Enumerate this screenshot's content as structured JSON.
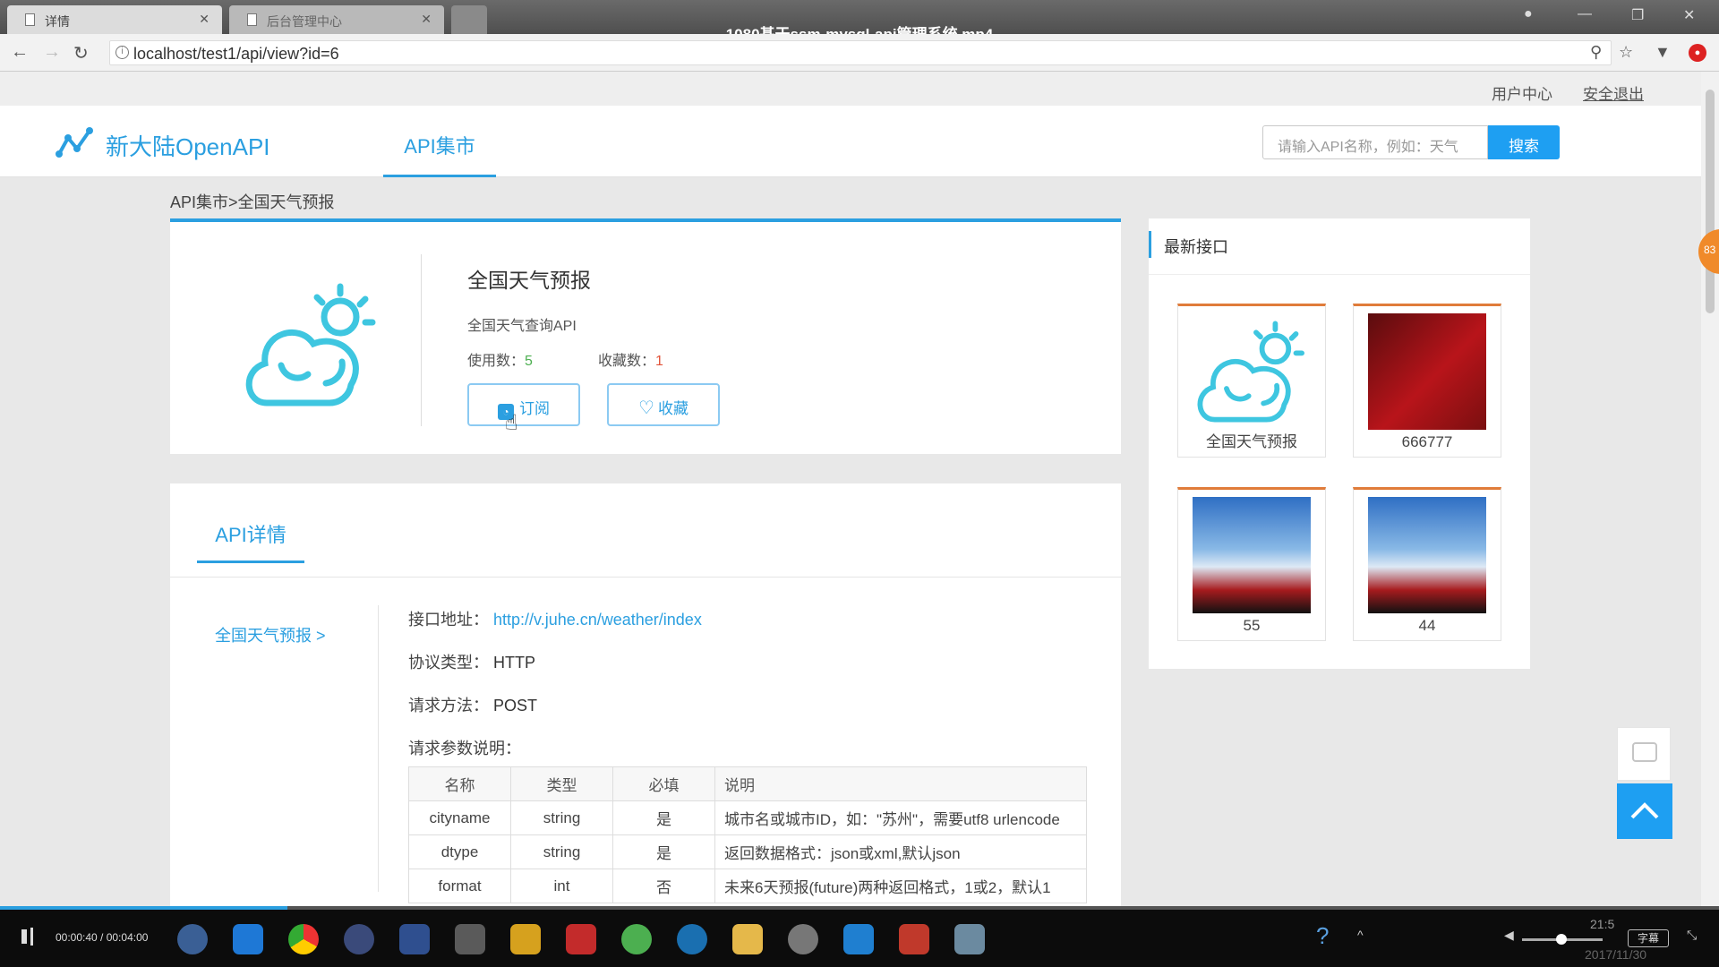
{
  "browser": {
    "tabs": [
      {
        "label": "详情"
      },
      {
        "label": "后台管理中心"
      }
    ],
    "video_title": "1080基于ssm-mysql-api管理系统.mp4",
    "url": "localhost/test1/api/view?id=6"
  },
  "userbar": {
    "user_center": "用户中心",
    "logout": "安全退出"
  },
  "header": {
    "logo_text": "新大陆OpenAPI",
    "nav_active": "API集市",
    "search_placeholder": "请输入API名称，例如：天气",
    "search_button": "搜索",
    "brand_color": "#2b9fe0"
  },
  "breadcrumb": "API集市>全国天气预报",
  "api": {
    "name": "全国天气预报",
    "desc": "全国天气查询API",
    "usage_label": "使用数：",
    "usage_count": "5",
    "fav_label": "收藏数：",
    "fav_count": "1",
    "subscribe_label": "订阅",
    "favorite_label": "收藏"
  },
  "detail": {
    "tab_label": "API详情",
    "side_link": "全国天气预报 >",
    "endpoint_label": "接口地址：",
    "endpoint": "http://v.juhe.cn/weather/index",
    "protocol_label": "协议类型：",
    "protocol": "HTTP",
    "method_label": "请求方法：",
    "method": "POST",
    "params_label": "请求参数说明：",
    "params_headers": [
      "名称",
      "类型",
      "必填",
      "说明"
    ],
    "params": [
      {
        "name": "cityname",
        "type": "string",
        "required": "是",
        "desc": "城市名或城市ID，如：\"苏州\"，需要utf8 urlencode"
      },
      {
        "name": "dtype",
        "type": "string",
        "required": "是",
        "desc": "返回数据格式：json或xml,默认json"
      },
      {
        "name": "format",
        "type": "int",
        "required": "否",
        "desc": "未来6天预报(future)两种返回格式，1或2，默认1"
      }
    ]
  },
  "sidebar": {
    "title": "最新接口",
    "items": [
      {
        "caption": "全国天气预报",
        "icon": "weather-icon"
      },
      {
        "caption": "666777",
        "icon": "poster-image"
      },
      {
        "caption": "55",
        "icon": "poster-image"
      },
      {
        "caption": "44",
        "icon": "poster-image"
      }
    ]
  },
  "player": {
    "time": "00:00:40 / 00:04:00",
    "progress": 0.167,
    "subtitle": "字幕",
    "clock": "21:5",
    "date": "2017/11/30"
  },
  "side_badge": "83"
}
